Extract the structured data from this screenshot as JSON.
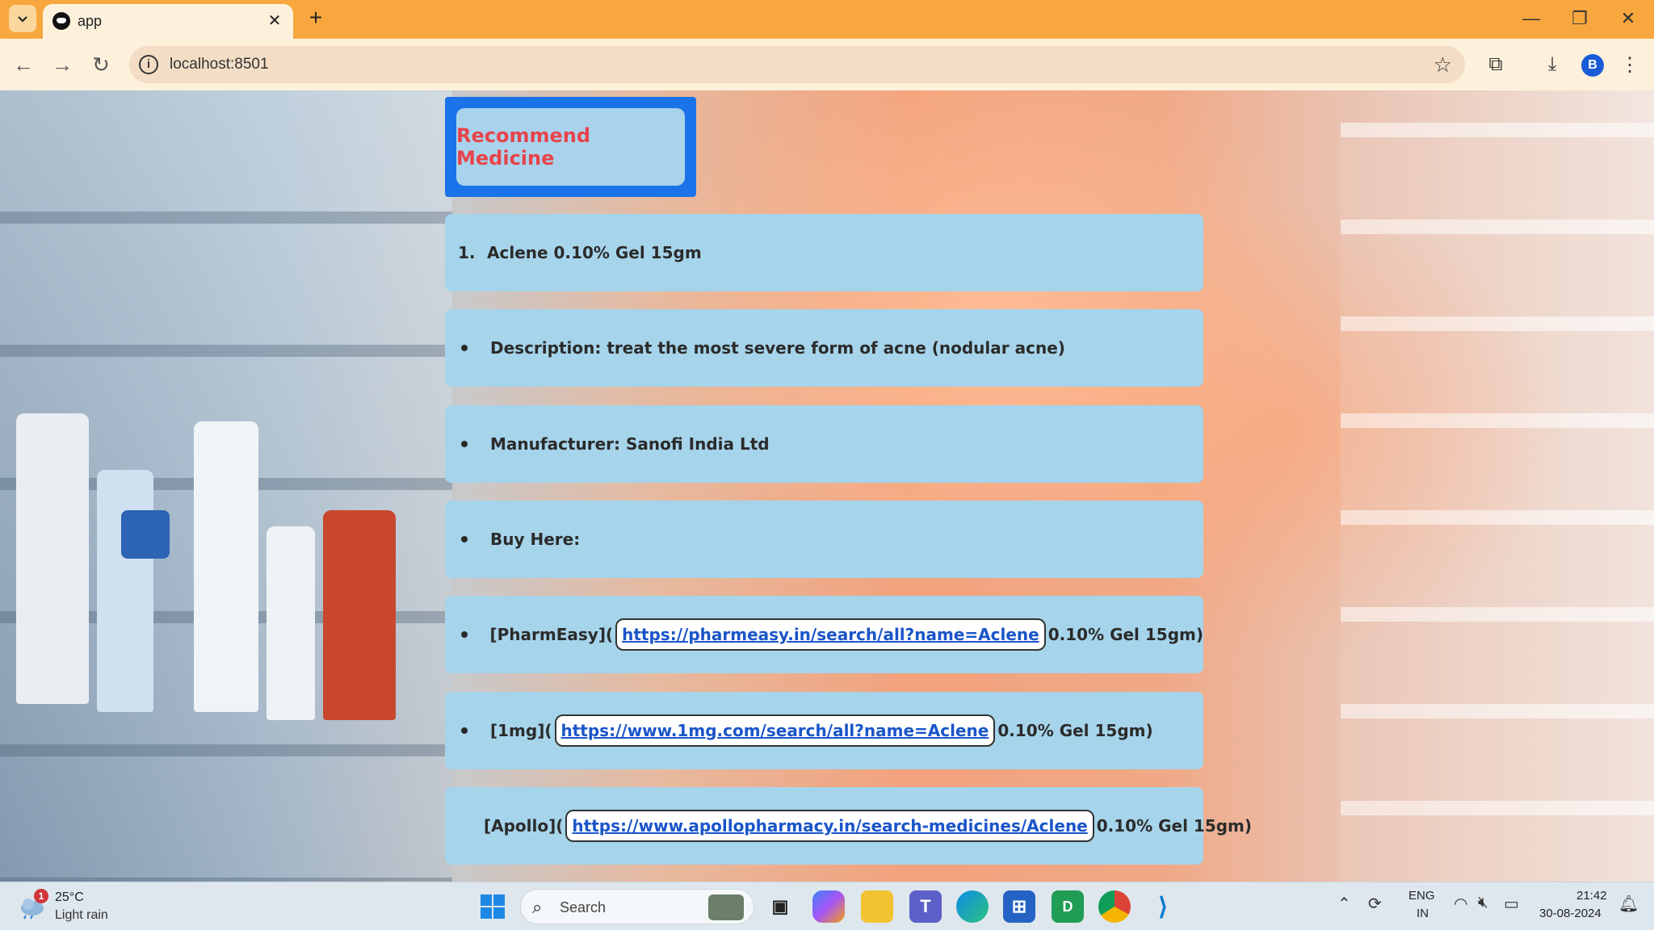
{
  "browser": {
    "tab_title": "app",
    "url": "localhost:8501",
    "profile_initial": "B"
  },
  "page": {
    "title": "Recommend Medicine",
    "items": [
      {
        "marker": "1.",
        "text": "Aclene 0.10% Gel 15gm"
      },
      {
        "marker": "bullet",
        "text": "Description: treat the most severe form of acne (nodular acne)"
      },
      {
        "marker": "bullet",
        "text": "Manufacturer: Sanofi India Ltd"
      },
      {
        "marker": "bullet",
        "text": "Buy Here:"
      }
    ],
    "links": [
      {
        "prefix": "[PharmEasy](",
        "url": "https://pharmeasy.in/search/all?name=Aclene",
        "suffix": "0.10% Gel 15gm)"
      },
      {
        "prefix": "[1mg](",
        "url": "https://www.1mg.com/search/all?name=Aclene",
        "suffix": "0.10% Gel 15gm)"
      },
      {
        "prefix": "[Apollo](",
        "url": "https://www.apollopharmacy.in/search-medicines/Aclene",
        "suffix": "0.10% Gel 15gm)"
      }
    ]
  },
  "taskbar": {
    "weather_badge": "1",
    "weather_temp": "25°C",
    "weather_desc": "Light rain",
    "search_placeholder": "Search",
    "lang_top": "ENG",
    "lang_bottom": "IN",
    "time": "21:42",
    "date": "30-08-2024"
  },
  "colors": {
    "titlebar": "#f8a73f",
    "title_border": "#1a73e8",
    "title_text": "#e8434b",
    "card_bg": "#a6d4eb",
    "link": "#1a55c9"
  }
}
